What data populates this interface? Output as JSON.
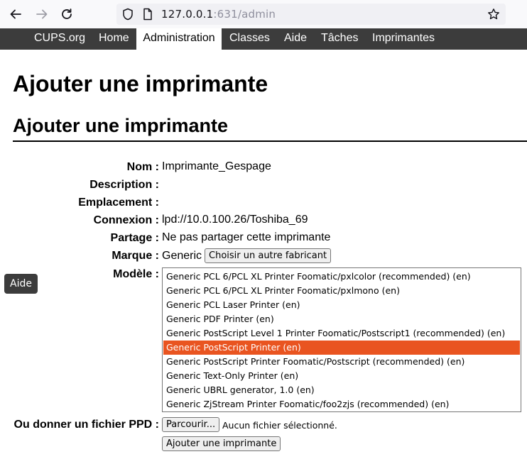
{
  "browser": {
    "url_host": "127.0.0.1",
    "url_rest": ":631/admin"
  },
  "nav": {
    "items": [
      "CUPS.org",
      "Home",
      "Administration",
      "Classes",
      "Aide",
      "Tâches",
      "Imprimantes"
    ],
    "active": "Administration"
  },
  "page": {
    "title": "Ajouter une imprimante",
    "subtitle": "Ajouter une imprimante"
  },
  "form": {
    "name_label": "Nom :",
    "name_value": "Imprimante_Gespage",
    "description_label": "Description :",
    "location_label": "Emplacement :",
    "connection_label": "Connexion :",
    "connection_value": "lpd://10.0.100.26/Toshiba_69",
    "sharing_label": "Partage :",
    "sharing_value": "Ne pas partager cette imprimante",
    "make_label": "Marque :",
    "make_value": "Generic",
    "change_make_button": "Choisir un autre fabricant",
    "model_label": "Modèle :",
    "models": [
      "Generic PCL 6/PCL XL Printer Foomatic/pxlcolor (recommended) (en)",
      "Generic PCL 6/PCL XL Printer Foomatic/pxlmono (en)",
      "Generic PCL Laser Printer (en)",
      "Generic PDF Printer (en)",
      "Generic PostScript Level 1 Printer Foomatic/Postscript1 (recommended) (en)",
      "Generic PostScript Printer (en)",
      "Generic PostScript Printer Foomatic/Postscript (recommended) (en)",
      "Generic Text-Only Printer (en)",
      "Generic UBRL generator, 1.0 (en)",
      "Generic ZjStream Printer Foomatic/foo2zjs (recommended) (en)"
    ],
    "selected_model": "Generic PostScript Printer (en)",
    "ppd_label": "Ou donner un fichier PPD :",
    "browse_button": "Parcourir...",
    "no_file_text": "Aucun fichier sélectionné.",
    "submit_button": "Ajouter une imprimante"
  },
  "help_tab": "Aide",
  "colors": {
    "nav_bg": "#3c3c3c",
    "selection": "#e95420"
  }
}
